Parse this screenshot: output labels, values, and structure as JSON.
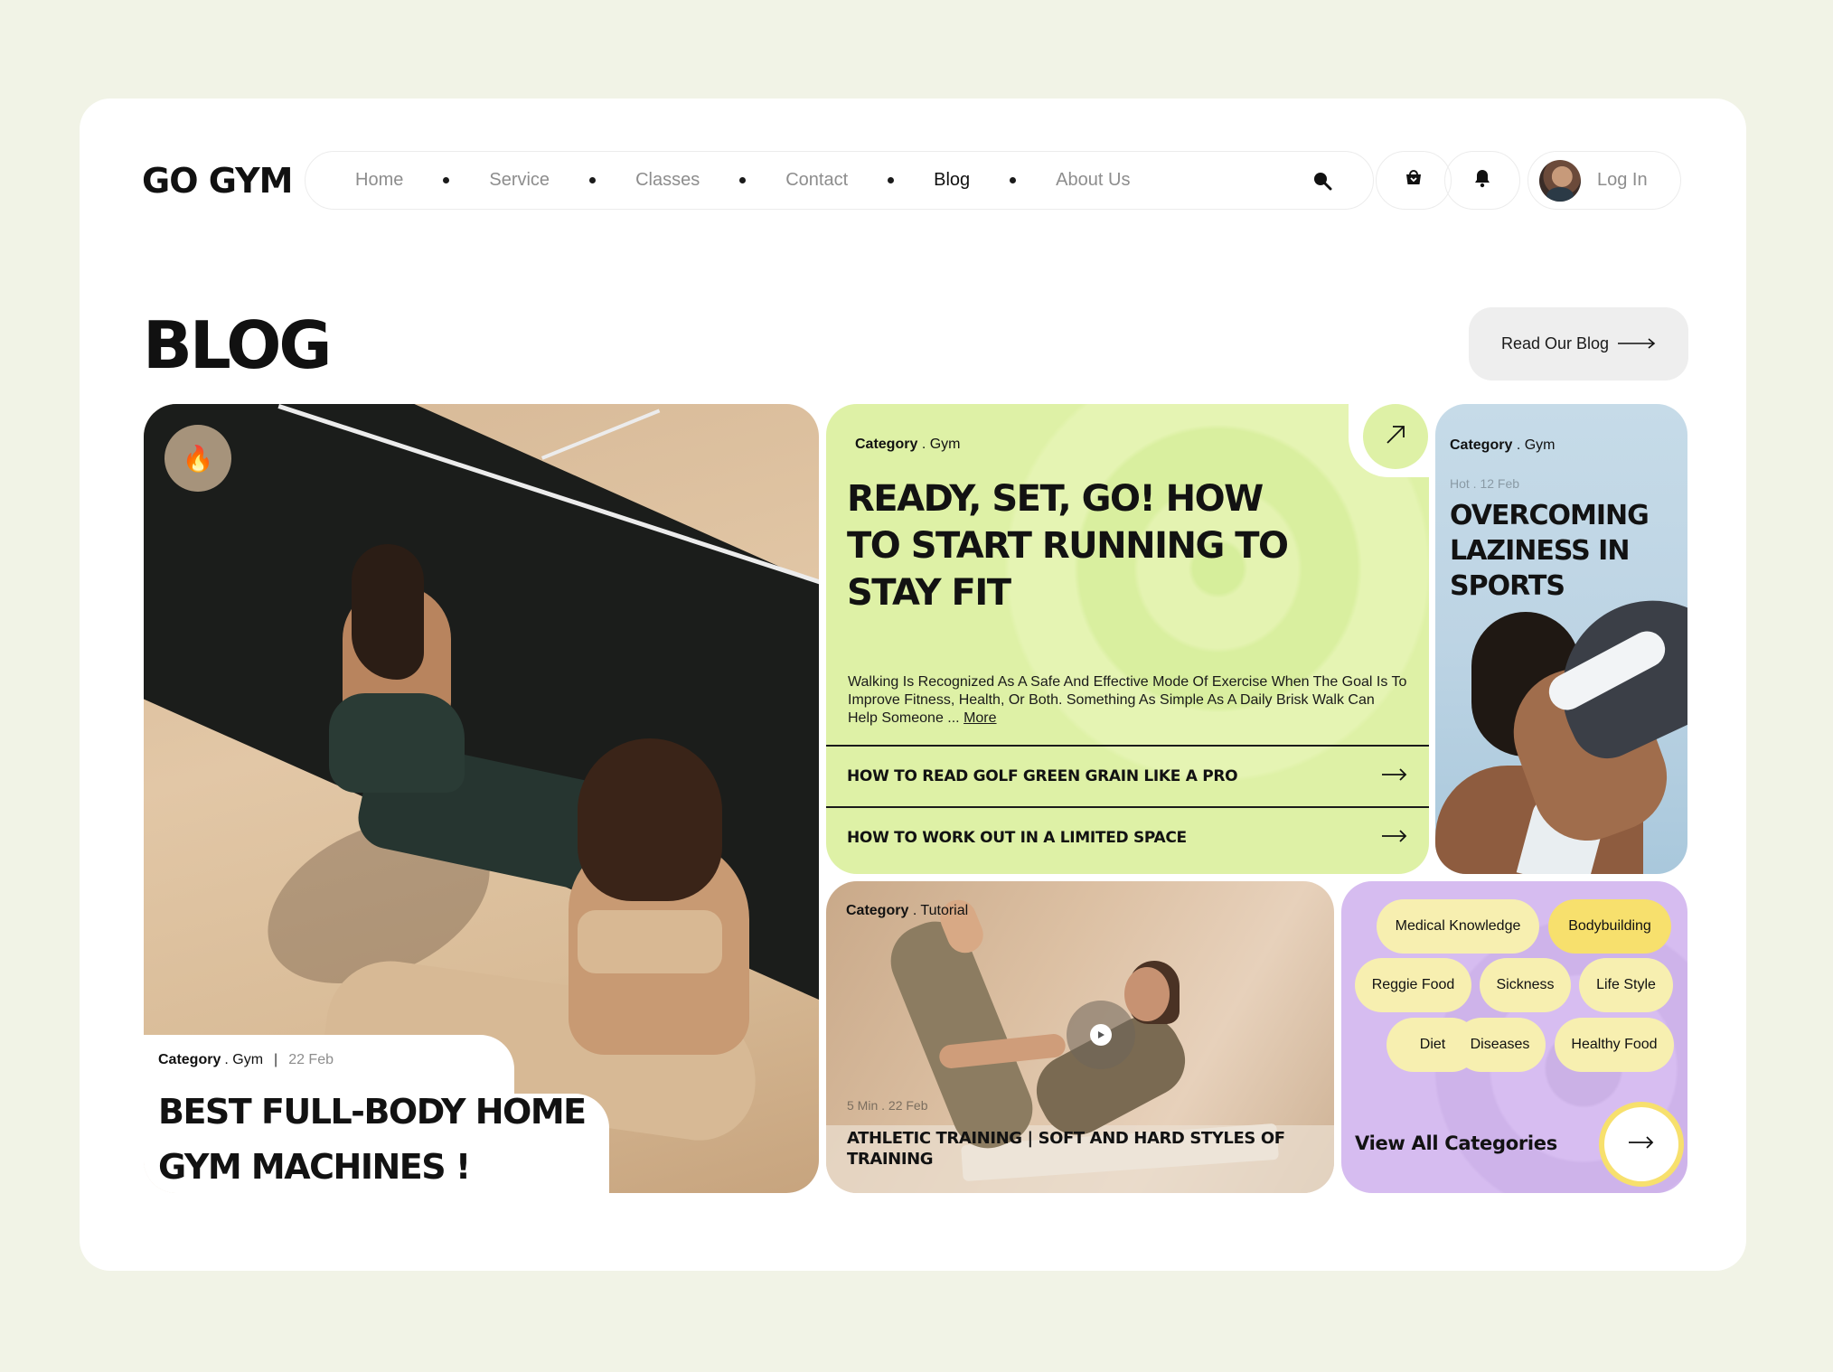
{
  "brand": {
    "logo": "GO GYM"
  },
  "nav": {
    "items": [
      "Home",
      "Service",
      "Classes",
      "Contact",
      "Blog",
      "About Us"
    ],
    "active": "Blog",
    "login_label": "Log In"
  },
  "page": {
    "title": "BLOG",
    "read_button": "Read Our Blog"
  },
  "featured_photo": {
    "category_label": "Category",
    "category_value": ". Gym",
    "separator": "|",
    "date": "22 Feb",
    "title": "BEST FULL-BODY HOME GYM MACHINES !",
    "badge_icon": "🔥"
  },
  "green_card": {
    "category_label": "Category",
    "category_value": ". Gym",
    "title": "READY, SET, GO! HOW TO START RUNNING TO STAY FIT",
    "description": "Walking Is Recognized As A Safe And Effective Mode Of Exercise When The Goal Is To Improve Fitness, Health, Or Both. Something As Simple As A Daily Brisk Walk Can Help Someone ...",
    "more_label": "More",
    "links": [
      "HOW TO READ GOLF GREEN GRAIN LIKE A PRO",
      "HOW TO WORK OUT IN A LIMITED SPACE"
    ]
  },
  "blue_card": {
    "category_label": "Category",
    "category_value": ". Gym",
    "meta": "Hot . 12 Feb",
    "title": "OVERCOMING LAZINESS IN SPORTS"
  },
  "tutorial_card": {
    "category_label": "Category",
    "category_value": ". Tutorial",
    "meta": "5 Min . 22 Feb",
    "title": "ATHLETIC TRAINING | SOFT AND HARD STYLES OF TRAINING"
  },
  "categories_card": {
    "chips": [
      "Medical Knowledge",
      "Bodybuilding",
      "Reggie Food",
      "Sickness",
      "Life Style",
      "Diet",
      "Diseases",
      "Healthy Food"
    ],
    "highlighted": "Bodybuilding",
    "view_all_label": "View All Categories"
  },
  "colors": {
    "page_bg": "#f1f3e6",
    "green_card": "#def1a6",
    "blue_card": "#c6dbe8",
    "purple_card": "#d7bdf1",
    "chip": "#f7efb0",
    "chip_highlight": "#f7e06d"
  },
  "icons": [
    "search-icon",
    "cart-icon",
    "bell-icon",
    "fire-icon",
    "arrow-up-right-icon",
    "arrow-right-icon",
    "play-icon"
  ]
}
